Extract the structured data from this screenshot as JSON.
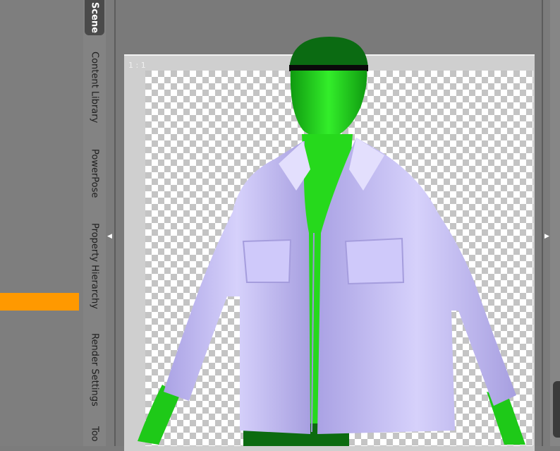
{
  "tabs": [
    {
      "label": "Scene",
      "active": true
    },
    {
      "label": "Content Library",
      "active": false
    },
    {
      "label": "PowerPose",
      "active": false
    },
    {
      "label": "Property Hierarchy",
      "active": false
    },
    {
      "label": "Render Settings",
      "active": false
    },
    {
      "label": "Too",
      "active": false
    }
  ],
  "viewport": {
    "aspect_label": "1 : 1"
  },
  "colors": {
    "accent_orange": "#ff9900",
    "figure_green": "#22e61e",
    "jacket_lavender": "#c6bff5",
    "checker_light": "#ffffff",
    "checker_dark": "#c4c4c4"
  },
  "icons": {
    "left_collapse": "triangle-left-icon",
    "right_collapse": "triangle-right-icon"
  }
}
